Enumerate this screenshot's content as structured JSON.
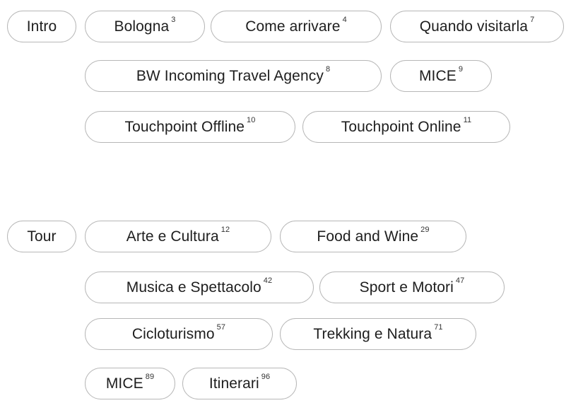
{
  "intro": {
    "label": "Intro",
    "items": [
      {
        "label": "Bologna",
        "page": "3"
      },
      {
        "label": "Come arrivare",
        "page": "4"
      },
      {
        "label": "Quando visitarla",
        "page": "7"
      },
      {
        "label": "BW Incoming Travel Agency",
        "page": "8"
      },
      {
        "label": "MICE",
        "page": "9"
      },
      {
        "label": "Touchpoint Offline",
        "page": "10"
      },
      {
        "label": "Touchpoint Online",
        "page": "11"
      }
    ]
  },
  "tour": {
    "label": "Tour",
    "items": [
      {
        "label": "Arte e Cultura",
        "page": "12"
      },
      {
        "label": "Food and Wine",
        "page": "29"
      },
      {
        "label": "Musica e Spettacolo",
        "page": "42"
      },
      {
        "label": "Sport e Motori",
        "page": "47"
      },
      {
        "label": "Cicloturismo",
        "page": "57"
      },
      {
        "label": "Trekking e Natura",
        "page": "71"
      },
      {
        "label": "MICE",
        "page": "89"
      },
      {
        "label": "Itinerari",
        "page": "96"
      }
    ]
  }
}
